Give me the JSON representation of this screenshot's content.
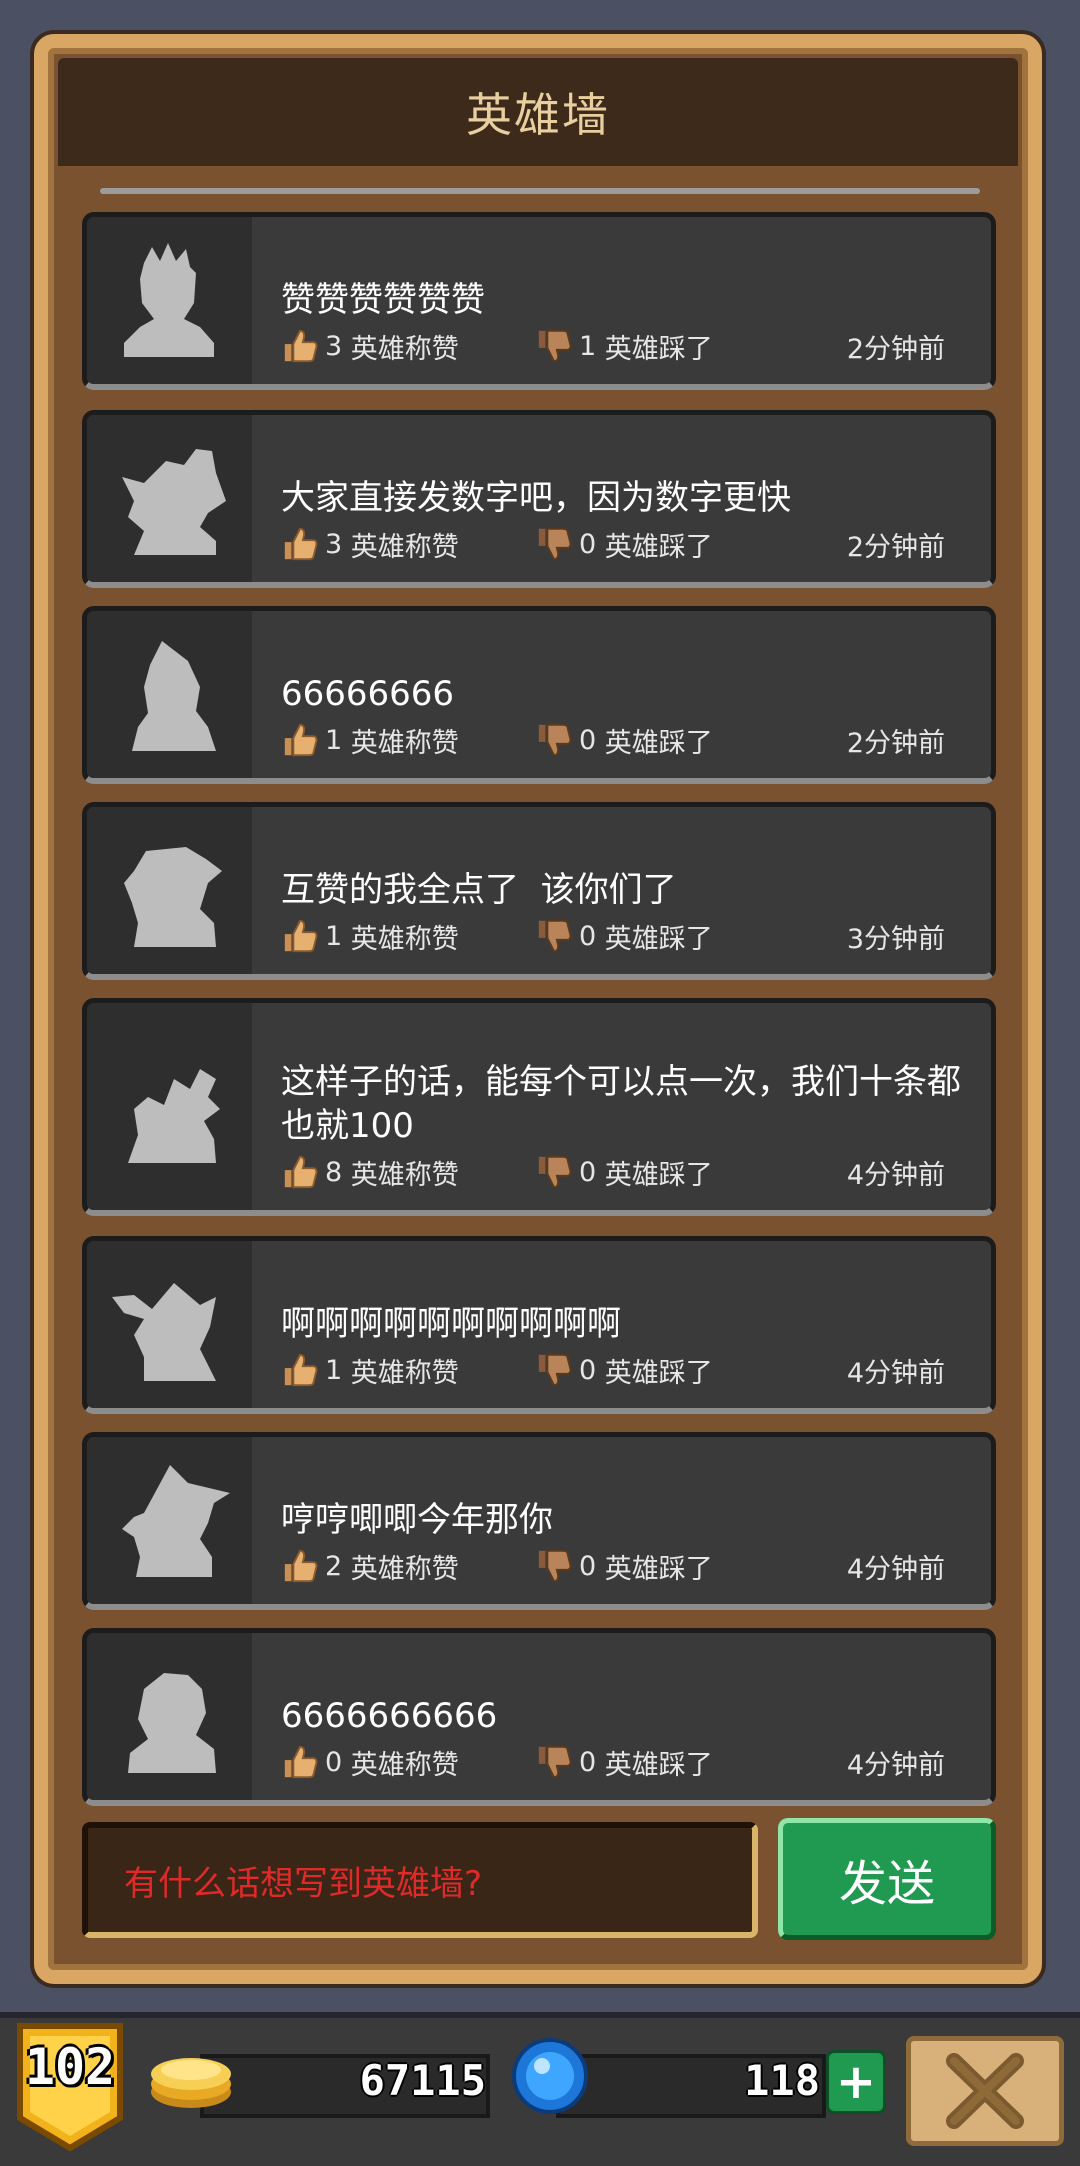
{
  "colors": {
    "background": "#4b5163",
    "panel_wood": "#7b5230",
    "panel_border": "#d9a763",
    "title_bar": "#3d2a1a",
    "title_text": "#e8cfa0",
    "card_bg": "#3a3a3a",
    "avatar_silhouette": "#bdbdbd",
    "placeholder_red": "#e02a2a",
    "send_green": "#1f9a50",
    "badge_gold": "#f2b21c"
  },
  "header": {
    "title": "英雄墙"
  },
  "posts": [
    {
      "avatar_icon": "spiky-hair-hero-silhouette-icon",
      "text": "赞赞赞赞赞赞",
      "likes": "3",
      "like_label": "英雄称赞",
      "dislikes": "1",
      "dislike_label": "英雄踩了",
      "time": "2分钟前"
    },
    {
      "avatar_icon": "beast-hero-silhouette-icon",
      "text": "大家直接发数字吧，因为数字更快",
      "likes": "3",
      "like_label": "英雄称赞",
      "dislikes": "0",
      "dislike_label": "英雄踩了",
      "time": "2分钟前"
    },
    {
      "avatar_icon": "hooded-hero-silhouette-icon",
      "text": "66666666",
      "likes": "1",
      "like_label": "英雄称赞",
      "dislikes": "0",
      "dislike_label": "英雄踩了",
      "time": "2分钟前"
    },
    {
      "avatar_icon": "capped-hero-silhouette-icon",
      "text": "互赞的我全点了  该你们了",
      "likes": "1",
      "like_label": "英雄称赞",
      "dislikes": "0",
      "dislike_label": "英雄踩了",
      "time": "3分钟前"
    },
    {
      "avatar_icon": "dragon-hero-silhouette-icon",
      "text": "这样子的话，能每个可以点一次，我们十条都也就100",
      "likes": "8",
      "like_label": "英雄称赞",
      "dislikes": "0",
      "dislike_label": "英雄踩了",
      "time": "4分钟前"
    },
    {
      "avatar_icon": "mage-hero-silhouette-icon",
      "text": "啊啊啊啊啊啊啊啊啊啊",
      "likes": "1",
      "like_label": "英雄称赞",
      "dislikes": "0",
      "dislike_label": "英雄踩了",
      "time": "4分钟前"
    },
    {
      "avatar_icon": "witch-hat-hero-silhouette-icon",
      "text": "哼哼唧唧今年那你",
      "likes": "2",
      "like_label": "英雄称赞",
      "dislikes": "0",
      "dislike_label": "英雄踩了",
      "time": "4分钟前"
    },
    {
      "avatar_icon": "knight-hero-silhouette-icon",
      "text": "6666666666",
      "likes": "0",
      "like_label": "英雄称赞",
      "dislikes": "0",
      "dislike_label": "英雄踩了",
      "time": "4分钟前"
    }
  ],
  "composer": {
    "placeholder": "有什么话想写到英雄墙?",
    "send_label": "发送"
  },
  "resources": {
    "level": "102",
    "gold": "67115",
    "gems": "118",
    "plus_label": "+"
  }
}
